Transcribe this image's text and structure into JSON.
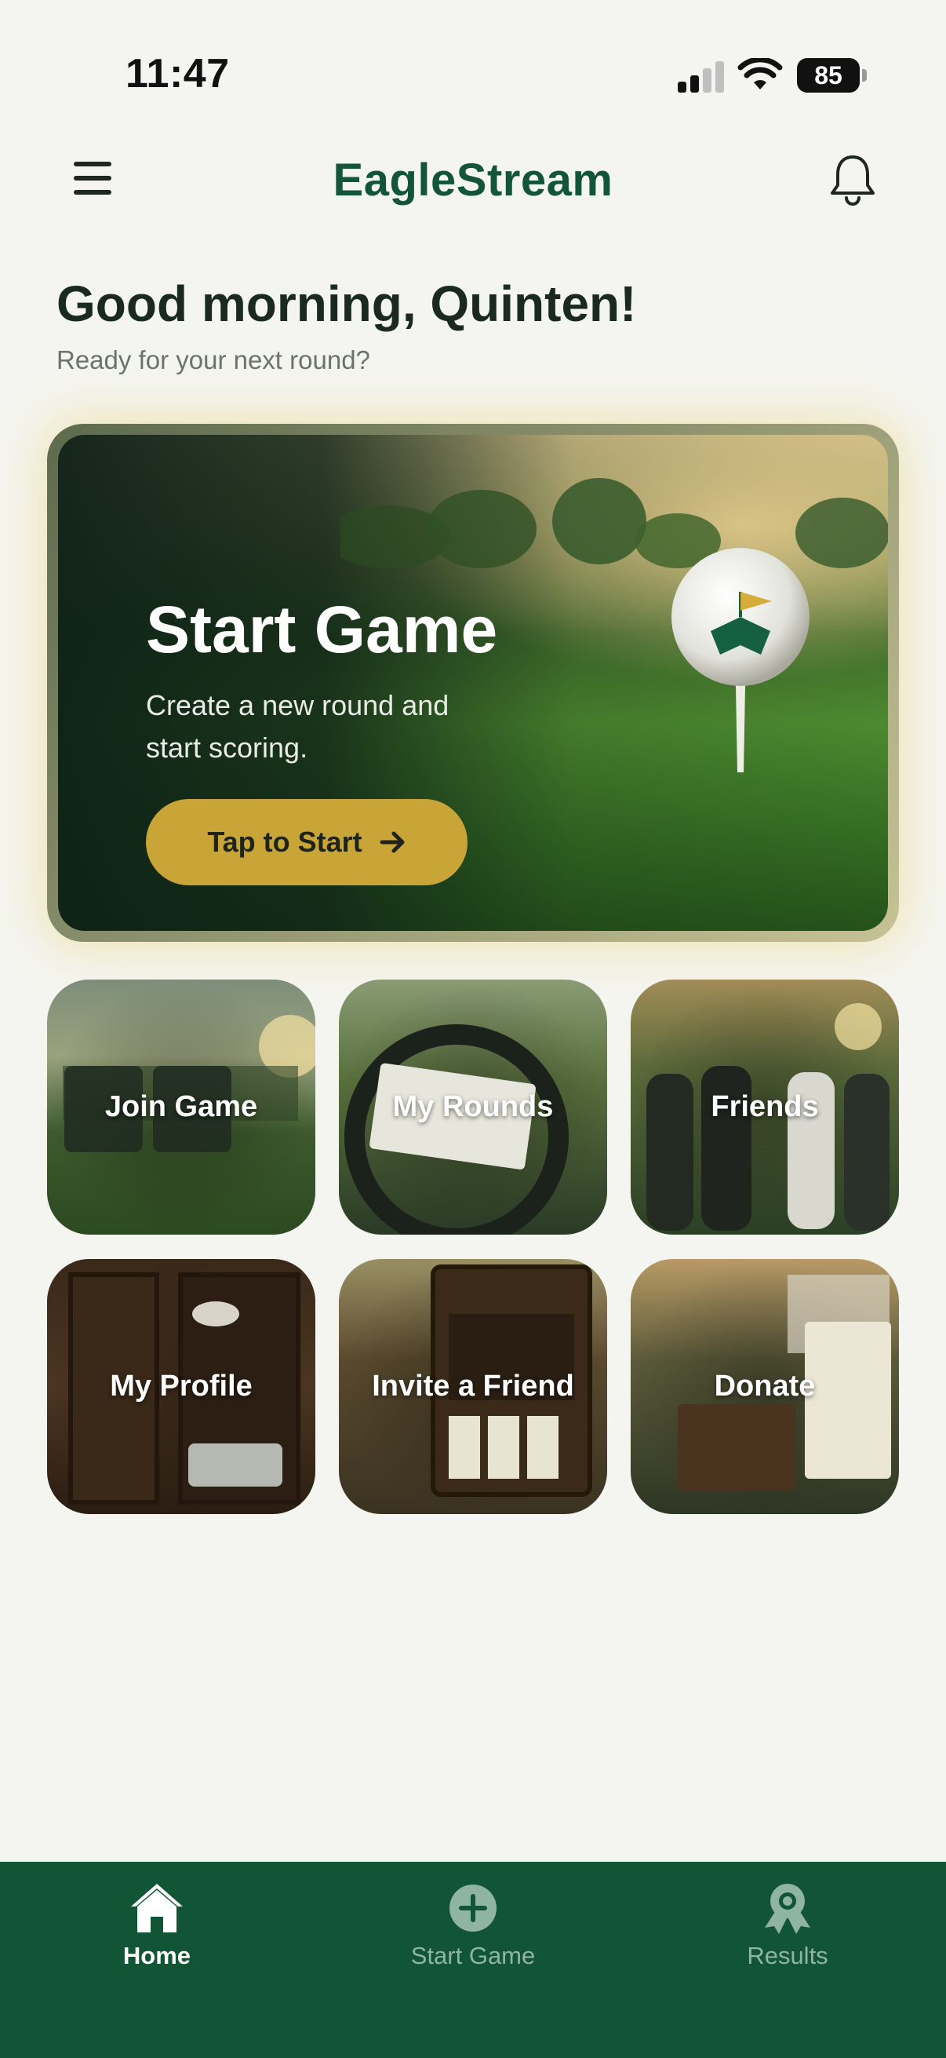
{
  "status_bar": {
    "time": "11:47",
    "battery": "85"
  },
  "header": {
    "title": "EagleStream",
    "menu_icon": "hamburger-menu-icon",
    "bell_icon": "bell-icon"
  },
  "greeting": {
    "title": "Good morning, Quinten!",
    "subtitle": "Ready for your next round?"
  },
  "hero": {
    "title": "Start Game",
    "description": "Create a new round and start scoring.",
    "button_label": "Tap to Start",
    "button_icon": "arrow-right-icon"
  },
  "tiles": [
    {
      "label": "Join Game"
    },
    {
      "label": "My Rounds"
    },
    {
      "label": "Friends"
    },
    {
      "label": "My Profile"
    },
    {
      "label": "Invite a Friend"
    },
    {
      "label": "Donate"
    }
  ],
  "bottom_nav": [
    {
      "label": "Home",
      "icon": "home-icon",
      "active": true
    },
    {
      "label": "Start Game",
      "icon": "plus-circle-icon",
      "active": false
    },
    {
      "label": "Results",
      "icon": "award-ribbon-icon",
      "active": false
    }
  ],
  "colors": {
    "brand": "#13553a",
    "accent": "#c9a537",
    "nav_background": "#115436",
    "background": "#f4f5f0"
  }
}
